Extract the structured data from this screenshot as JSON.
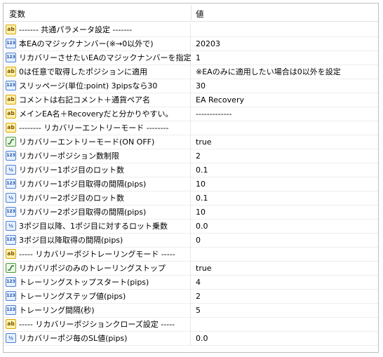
{
  "header": {
    "name_col": "変数",
    "value_col": "値"
  },
  "rows": [
    {
      "type": "ab",
      "name": "------- 共通パラメータ設定 -------",
      "value": ""
    },
    {
      "type": "int",
      "name": "本EAのマジックナンバー(※→0以外で)",
      "value": "20203"
    },
    {
      "type": "int",
      "name": "リカバリーさせたいEAのマジックナンバーを指定",
      "value": "1"
    },
    {
      "type": "ab",
      "name": "0は任意で取得したポジションに適用",
      "value": "※EAのみに適用したい場合は0以外を設定"
    },
    {
      "type": "int",
      "name": "スリッページ(単位:point) 3pipsなら30",
      "value": "30"
    },
    {
      "type": "ab",
      "name": "コメントは右記コメント＋通貨ペア名",
      "value": "EA Recovery"
    },
    {
      "type": "ab",
      "name": "メインEA名＋Recoveryだと分かりやすい。",
      "value": "-------------"
    },
    {
      "type": "ab",
      "name": "-------- リカバリーエントリーモード --------",
      "value": ""
    },
    {
      "type": "bool",
      "name": "リカバリーエントリーモード(ON OFF)",
      "value": "true"
    },
    {
      "type": "int",
      "name": "リカバリーポジション数制限",
      "value": "2"
    },
    {
      "type": "dbl",
      "name": "リカバリー1ポジ目のロット数",
      "value": "0.1"
    },
    {
      "type": "int",
      "name": "リカバリー1ポジ目取得の間隔(pips)",
      "value": "10"
    },
    {
      "type": "dbl",
      "name": "リカバリー2ポジ目のロット数",
      "value": "0.1"
    },
    {
      "type": "int",
      "name": "リカバリー2ポジ目取得の間隔(pips)",
      "value": "10"
    },
    {
      "type": "dbl",
      "name": "3ポジ目以降、1ポジ目に対するロット乗数",
      "value": "0.0"
    },
    {
      "type": "int",
      "name": "3ポジ目以降取得の間隔(pips)",
      "value": "0"
    },
    {
      "type": "ab",
      "name": "----- リカバリーポジトレーリングモード -----",
      "value": ""
    },
    {
      "type": "bool",
      "name": "リカバリポジのみのトレーリングストップ",
      "value": "true"
    },
    {
      "type": "int",
      "name": "トレーリングストップスタート(pips)",
      "value": "4"
    },
    {
      "type": "int",
      "name": "トレーリングステップ値(pips)",
      "value": "2"
    },
    {
      "type": "int",
      "name": "トレーリング間隔(秒)",
      "value": "5"
    },
    {
      "type": "ab",
      "name": "----- リカバリーポジションクローズ設定 -----",
      "value": ""
    },
    {
      "type": "dbl",
      "name": "リカバリーポジ毎のSL値(pips)",
      "value": "0.0"
    }
  ],
  "icons": {
    "ab": "string-type-icon",
    "int": "integer-type-icon",
    "dbl": "double-type-icon",
    "bool": "boolean-type-icon"
  }
}
